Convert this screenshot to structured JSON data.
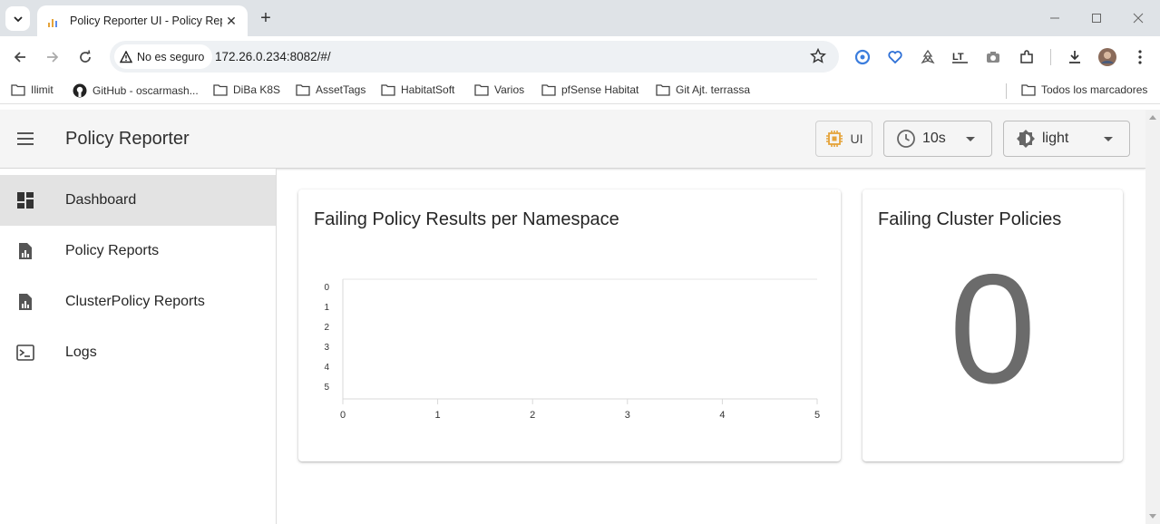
{
  "browser": {
    "tab_title": "Policy Reporter UI - Policy Repo",
    "security_label": "No es seguro",
    "url": "172.26.0.234:8082/#/",
    "bookmarks": [
      {
        "label": "Ilimit",
        "icon": "folder-icon"
      },
      {
        "label": "GitHub - oscarmash...",
        "icon": "github-icon"
      },
      {
        "label": "DiBa K8S",
        "icon": "folder-icon"
      },
      {
        "label": "AssetTags",
        "icon": "folder-icon"
      },
      {
        "label": "HabitatSoft",
        "icon": "folder-icon"
      },
      {
        "label": "Varios",
        "icon": "folder-icon"
      },
      {
        "label": "pfSense Habitat",
        "icon": "folder-icon"
      },
      {
        "label": "Git Ajt. terrassa",
        "icon": "folder-icon"
      }
    ],
    "all_bookmarks_label": "Todos los marcadores"
  },
  "app": {
    "title": "Policy Reporter",
    "ui_button_label": "UI",
    "refresh_select_value": "10s",
    "theme_select_value": "light",
    "nav": [
      {
        "label": "Dashboard",
        "icon": "dashboard-icon",
        "active": true
      },
      {
        "label": "Policy Reports",
        "icon": "report-icon",
        "active": false
      },
      {
        "label": "ClusterPolicy Reports",
        "icon": "report-icon",
        "active": false
      },
      {
        "label": "Logs",
        "icon": "terminal-icon",
        "active": false
      }
    ]
  },
  "cards": {
    "namespace_title": "Failing Policy Results per Namespace",
    "cluster_title": "Failing Cluster Policies",
    "cluster_value": "0"
  },
  "chart_data": {
    "type": "bar",
    "title": "",
    "y_tick_labels": [
      "0",
      "1",
      "2",
      "3",
      "4",
      "5"
    ],
    "x_tick_labels": [
      "0",
      "1",
      "2",
      "3",
      "4",
      "5"
    ],
    "xlim": [
      0,
      5
    ],
    "categories": [],
    "series": []
  },
  "colors": {
    "accent": "#e5a33a",
    "big_number": "#6b6b6b"
  }
}
